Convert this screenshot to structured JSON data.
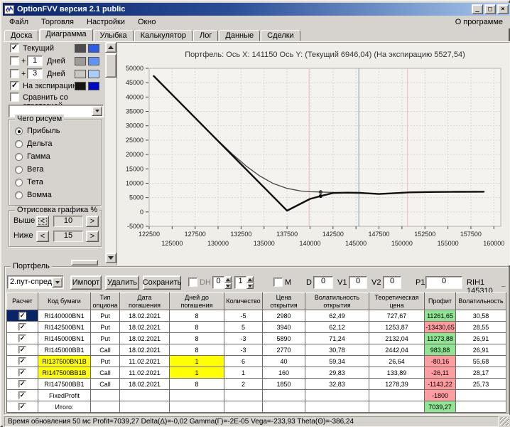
{
  "window": {
    "title": "OptionFVV версия 2.1 public",
    "controls": {
      "minimize": "_",
      "maximize": "□",
      "close": "×"
    }
  },
  "menu": {
    "items": [
      "Файл",
      "Торговля",
      "Настройки",
      "Окно"
    ],
    "right": "О программе"
  },
  "tabs": {
    "items": [
      "Доска",
      "Диаграмма",
      "Улыбка",
      "Калькулятор",
      "Лог",
      "Данные",
      "Сделки"
    ],
    "active": "Диаграмма"
  },
  "left_panel": {
    "series_toggles": [
      {
        "checked": true,
        "label": "Текущий",
        "swatches": [
          "#4d4d4d",
          "#2e5be8"
        ]
      },
      {
        "checked": false,
        "label": "+",
        "value": "1",
        "suffix": "Дней",
        "swatches": [
          "#9e9b96",
          "#5f93f5"
        ]
      },
      {
        "checked": false,
        "label": "+",
        "value": "3",
        "suffix": "Дней",
        "swatches": [
          "#c9c6c1",
          "#a9ceff"
        ]
      },
      {
        "checked": true,
        "label": "На экспирацию",
        "swatches": [
          "#141414",
          "#0008c8"
        ]
      }
    ],
    "compare_checkbox": {
      "checked": false,
      "label": "Сравнить со стратегией"
    },
    "strategy_dropdown_value": "",
    "draw_group": {
      "title": "Чего рисуем",
      "options": [
        "Прибыль",
        "Дельта",
        "Гамма",
        "Вега",
        "Тета",
        "Вомма"
      ],
      "selected": "Прибыль"
    },
    "range_group": {
      "title": "Отрисовка графика %",
      "dec_label": "<",
      "inc_label": ">",
      "rows": [
        {
          "label": "Выше",
          "value": "10"
        },
        {
          "label": "Ниже",
          "value": "15"
        }
      ]
    }
  },
  "chart_data": {
    "type": "line",
    "title": "Портфель: Ось X: 141150 Ось Y:  (Текущий 6946,04)  (На экспирацию 5527,54)",
    "xlabel": "",
    "ylabel": "",
    "xlim": [
      122500,
      160750
    ],
    "ylim": [
      -5000,
      50000
    ],
    "grid": true,
    "x_tick_step": 2500,
    "x_ticks_row1": [
      122500,
      127500,
      132500,
      137500,
      142500,
      147500,
      152500,
      157500
    ],
    "x_ticks_row2": [
      125000,
      130000,
      135000,
      140000,
      145000,
      150000,
      155000,
      160000
    ],
    "y_ticks": [
      50000,
      45000,
      40000,
      35000,
      30000,
      25000,
      20000,
      15000,
      10000,
      5000,
      0,
      -5000
    ],
    "plot_bg": "#f4f3ef",
    "plot_border": "#b6b2aa",
    "grid_color": "#d7d5cf",
    "cursor": {
      "x": 141150,
      "current_y": "6946,04",
      "expiration_y": "5527,54"
    },
    "vlines": [
      {
        "x": 139900,
        "color": "#f2b9c4"
      },
      {
        "x": 145310,
        "color": "#8494ab"
      },
      {
        "x": 150600,
        "color": "#f2b9c4"
      }
    ],
    "series": [
      {
        "key": "current",
        "name": "Текущий",
        "color": "#454545",
        "width": 1.3,
        "points": [
          [
            123000,
            47300
          ],
          [
            126500,
            36000
          ],
          [
            129500,
            26400
          ],
          [
            131500,
            20300
          ],
          [
            133000,
            16100
          ],
          [
            134500,
            12600
          ],
          [
            136000,
            9900
          ],
          [
            137500,
            8200
          ],
          [
            139000,
            7300
          ],
          [
            140000,
            7050
          ],
          [
            141150,
            6946
          ],
          [
            142500,
            6800
          ],
          [
            144500,
            6700
          ],
          [
            146000,
            6500
          ],
          [
            147500,
            6250
          ],
          [
            149200,
            6550
          ],
          [
            150800,
            6820
          ],
          [
            153000,
            6950
          ],
          [
            156000,
            7020
          ],
          [
            158900,
            7050
          ]
        ]
      },
      {
        "key": "expiration",
        "name": "На экспирацию",
        "color": "#101010",
        "width": 2.4,
        "points": [
          [
            123000,
            47300
          ],
          [
            137500,
            450
          ],
          [
            140000,
            4550
          ],
          [
            141150,
            5527
          ],
          [
            142500,
            6600
          ],
          [
            144000,
            6720
          ],
          [
            145500,
            6650
          ],
          [
            147500,
            6250
          ],
          [
            149200,
            6550
          ],
          [
            150800,
            6820
          ],
          [
            153000,
            6950
          ],
          [
            156000,
            7020
          ],
          [
            158900,
            7050
          ]
        ]
      }
    ],
    "markers": [
      {
        "x": 141150,
        "y": 6946,
        "color": "#3a3a3a"
      },
      {
        "x": 141150,
        "y": 5527,
        "color": "#101010"
      }
    ]
  },
  "portfolio": {
    "group_title": "Портфель",
    "combo_value": "2.пут-спред",
    "buttons": [
      "Импорт",
      "Удалить",
      "Сохранить"
    ],
    "dh": {
      "checked": false,
      "label": "DH",
      "spin1": "0",
      "spin2": "1"
    },
    "m": {
      "checked": false,
      "label": "M"
    },
    "fields": [
      {
        "label": "D",
        "value": "0"
      },
      {
        "label": "V1",
        "value": "0"
      },
      {
        "label": "V2",
        "value": "0"
      },
      {
        "label": "P1",
        "value": "0"
      }
    ],
    "instrument": "RIH1 145310",
    "collapse_label": "_"
  },
  "table": {
    "columns": [
      "Расчет",
      "Код бумаги",
      "Тип опциона",
      "Дата погашения",
      "Дней до погашения",
      "Количество",
      "Цена открытия",
      "Волатильность открытия",
      "Теоретическая цена",
      "Профит",
      "Волатильность"
    ],
    "rows": [
      {
        "checked": true,
        "selected": true,
        "code": "RI140000BN1",
        "type": "Put",
        "date": "18.02.2021",
        "days": "8",
        "qty": "-5",
        "price": "2980",
        "vol_open": "62,49",
        "theo": "727,67",
        "profit": "11261,65",
        "profit_color": "green",
        "vol": "30,58"
      },
      {
        "checked": true,
        "code": "RI142500BN1",
        "type": "Put",
        "date": "18.02.2021",
        "days": "8",
        "qty": "5",
        "price": "3940",
        "vol_open": "62,12",
        "theo": "1253,87",
        "profit": "-13430,65",
        "profit_color": "red",
        "vol": "28,55"
      },
      {
        "checked": true,
        "code": "RI145000BN1",
        "type": "Put",
        "date": "18.02.2021",
        "days": "8",
        "qty": "-3",
        "price": "5890",
        "vol_open": "71,24",
        "theo": "2132,04",
        "profit": "11273,88",
        "profit_color": "green",
        "vol": "26,91"
      },
      {
        "checked": true,
        "code": "RI145000BB1",
        "type": "Call",
        "date": "18.02.2021",
        "days": "8",
        "qty": "-3",
        "price": "2770",
        "vol_open": "30,78",
        "theo": "2442,04",
        "profit": "983,88",
        "profit_color": "green",
        "vol": "26,91"
      },
      {
        "checked": true,
        "highlight": true,
        "code": "RI137500BN1B",
        "type": "Put",
        "date": "11.02.2021",
        "days": "1",
        "qty": "6",
        "price": "40",
        "vol_open": "59,34",
        "theo": "26,64",
        "profit": "-80,16",
        "profit_color": "red",
        "vol": "55,68"
      },
      {
        "checked": true,
        "highlight": true,
        "code": "RI147500BB1B",
        "type": "Call",
        "date": "11.02.2021",
        "days": "1",
        "qty": "1",
        "price": "160",
        "vol_open": "29,83",
        "theo": "133,89",
        "profit": "-26,11",
        "profit_color": "red",
        "vol": "28,17"
      },
      {
        "checked": true,
        "code": "RI147500BB1",
        "type": "Call",
        "date": "18.02.2021",
        "days": "8",
        "qty": "2",
        "price": "1850",
        "vol_open": "32,83",
        "theo": "1278,39",
        "profit": "-1143,22",
        "profit_color": "red",
        "vol": "25,73"
      },
      {
        "checked": true,
        "code": "FixedProfit",
        "profit": "-1800",
        "profit_color": "red"
      },
      {
        "checked": true,
        "code": "Итого:",
        "profit": "7039,27",
        "profit_color": "green"
      }
    ]
  },
  "status_bar": {
    "text": "Время обновления 50 мс  Profit=7039,27 Delta(Δ)=-0,02 Gamma(Γ)=-2E-05 Vega=-233,93 Theta(Θ)=-386,24"
  }
}
